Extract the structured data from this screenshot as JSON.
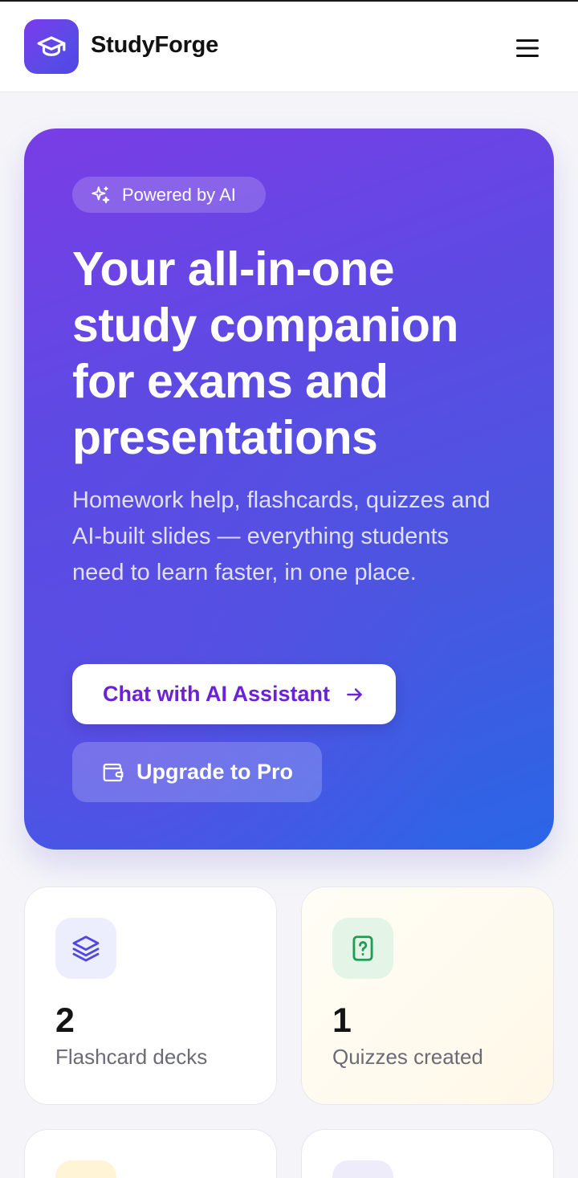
{
  "header": {
    "brand": "StudyForge",
    "logo_icon": "graduation-cap-icon",
    "menu_icon": "hamburger-menu-icon"
  },
  "hero": {
    "badge_icon": "sparkles-icon",
    "badge": "Powered by AI",
    "title": "Your all-in-one study companion for exams and presentations",
    "subtitle": "Homework help, flashcards, quizzes and AI-built slides — everything students need to learn faster, in one place.",
    "primary_cta": "Chat with AI Assistant",
    "primary_cta_icon": "arrow-right-icon",
    "secondary_cta": "Upgrade to Pro",
    "secondary_cta_icon": "wallet-icon"
  },
  "stats": [
    {
      "value": "2",
      "label": "Flashcard decks",
      "icon": "layers-icon"
    },
    {
      "value": "1",
      "label": "Quizzes created",
      "icon": "file-question-icon"
    }
  ],
  "colors": {
    "brand": "#7c3aed",
    "hero_start": "#7a3de6",
    "hero_end": "#2a66e6",
    "cta_text": "#6b21d8"
  }
}
